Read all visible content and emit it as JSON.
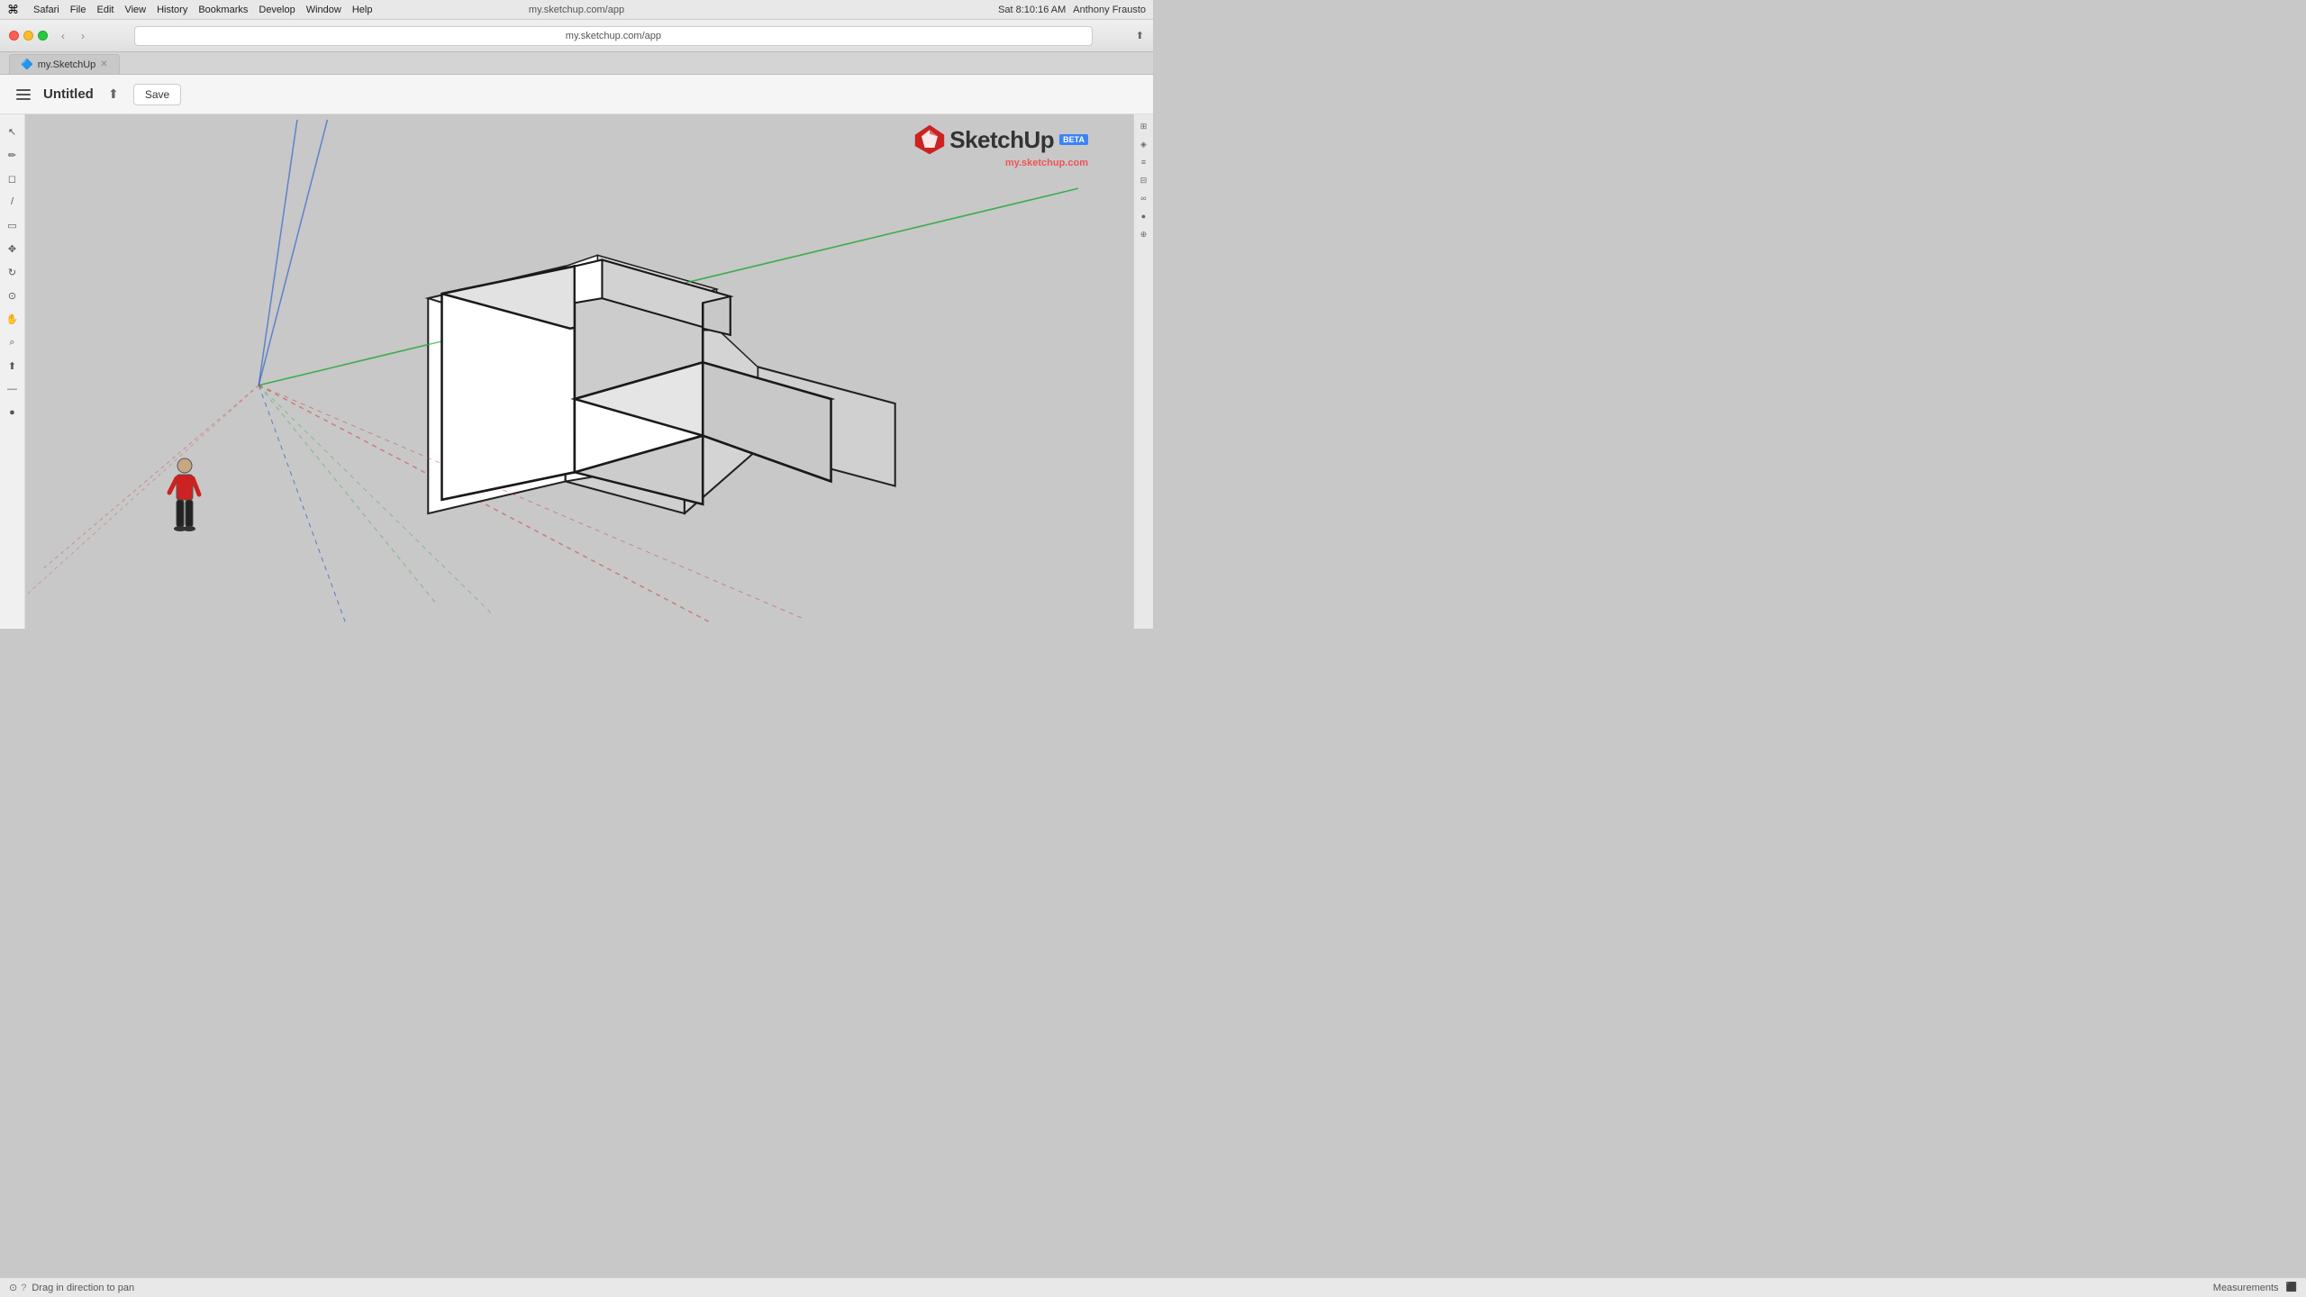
{
  "menubar": {
    "apple": "⌘",
    "app_name": "Safari",
    "items": [
      "Safari",
      "File",
      "Edit",
      "View",
      "History",
      "Bookmarks",
      "Develop",
      "Window",
      "Help"
    ],
    "url": "my.sketchup.com/app",
    "time": "Sat 8:10:16 AM",
    "user": "Anthony Frausto"
  },
  "browser": {
    "tab_label": "my.SketchUp",
    "tab_favicon": "🔷",
    "url_display": "my.sketchup.com/app"
  },
  "toolbar": {
    "doc_title": "Untitled",
    "save_label": "Save"
  },
  "logo": {
    "name": "SketchUp",
    "beta": "BETA",
    "url_prefix": "my.",
    "url_suffix": "sketchup.com"
  },
  "status": {
    "hint_icon": "?",
    "hint_text": "Drag in direction to pan",
    "measurements_label": "Measurements"
  },
  "tools": [
    {
      "name": "select",
      "icon": "↖",
      "label": "Select"
    },
    {
      "name": "pencil",
      "icon": "✏",
      "label": "Pencil"
    },
    {
      "name": "eraser",
      "icon": "◻",
      "label": "Eraser"
    },
    {
      "name": "line",
      "icon": "/",
      "label": "Line"
    },
    {
      "name": "rectangle",
      "icon": "▭",
      "label": "Rectangle"
    },
    {
      "name": "move",
      "icon": "✥",
      "label": "Move"
    },
    {
      "name": "rotate",
      "icon": "↻",
      "label": "Rotate"
    },
    {
      "name": "orbit",
      "icon": "⊙",
      "label": "Orbit"
    },
    {
      "name": "pan",
      "icon": "✋",
      "label": "Pan"
    },
    {
      "name": "zoom",
      "icon": "⌕",
      "label": "Zoom"
    },
    {
      "name": "pushpull",
      "icon": "⬆",
      "label": "Push/Pull"
    },
    {
      "name": "tape",
      "icon": "📏",
      "label": "Tape Measure"
    },
    {
      "name": "paint",
      "icon": "🪣",
      "label": "Paint Bucket"
    }
  ],
  "right_panel": [
    {
      "name": "scene",
      "icon": "⊞"
    },
    {
      "name": "style",
      "icon": "◈"
    },
    {
      "name": "layers",
      "icon": "≡"
    },
    {
      "name": "outliner",
      "icon": "⊟"
    },
    {
      "name": "components",
      "icon": "∞"
    },
    {
      "name": "materials",
      "icon": "●"
    },
    {
      "name": "entity",
      "icon": "⊕"
    }
  ],
  "colors": {
    "background": "#c8c8c8",
    "toolbar_bg": "#f5f5f5",
    "left_panel": "#f0f0f0",
    "accent_red": "#e55",
    "axis_blue": "#3366cc",
    "axis_green": "#33aa44",
    "axis_red": "#cc3333"
  }
}
